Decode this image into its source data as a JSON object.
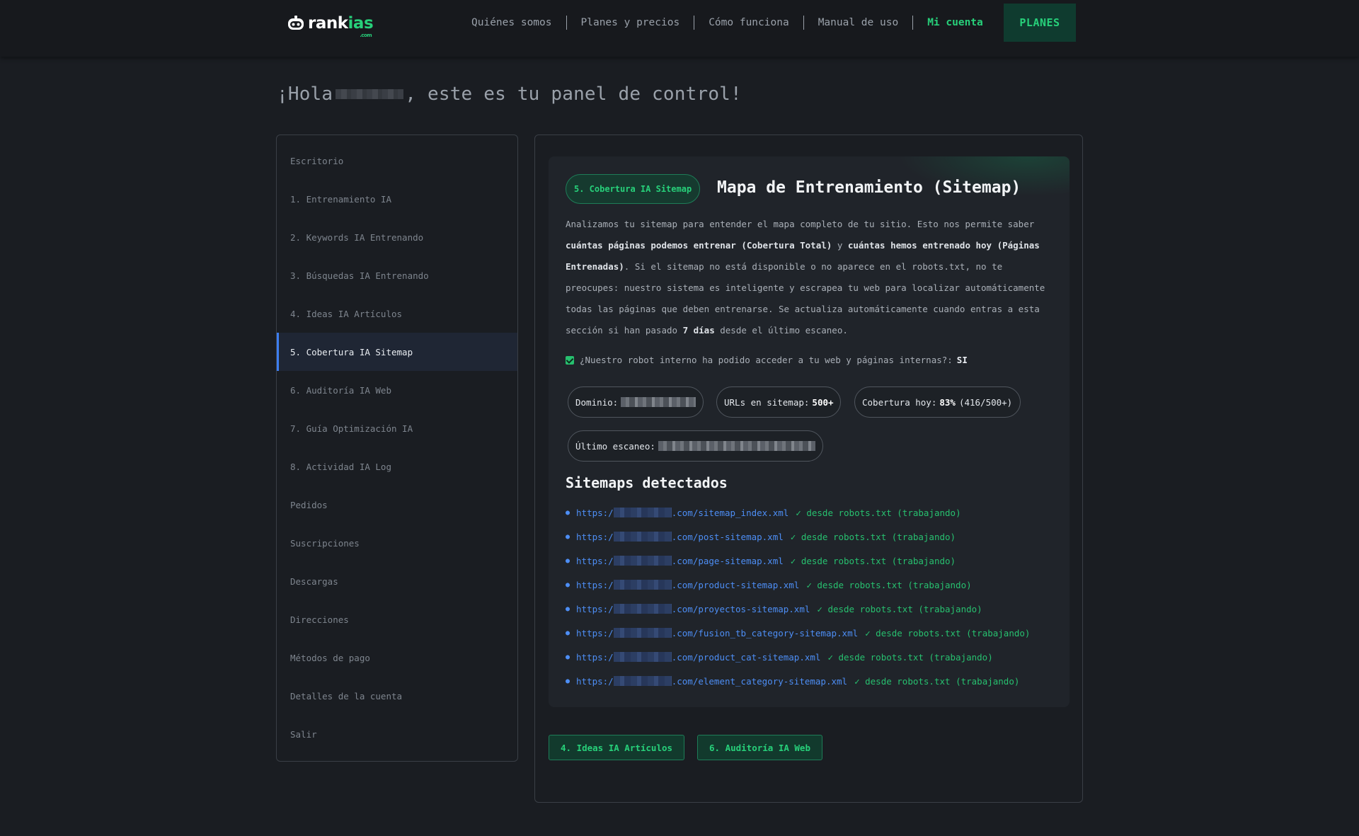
{
  "header": {
    "logo_text_white": "rank",
    "logo_text_green": "ias",
    "logo_sub": ".com",
    "nav": [
      "Quiénes somos",
      "Planes y precios",
      "Cómo funciona",
      "Manual de uso",
      "Mi cuenta"
    ],
    "active_nav": "Mi cuenta",
    "cta_label": "PLANES"
  },
  "greeting": {
    "prefix": "¡Hola",
    "suffix": ", este es tu panel de control!"
  },
  "sidebar": {
    "items": [
      "Escritorio",
      "1. Entrenamiento IA",
      "2. Keywords IA Entrenando",
      "3. Búsquedas IA Entrenando",
      "4. Ideas IA Artículos",
      "5. Cobertura IA Sitemap",
      "6. Auditoría IA Web",
      "7. Guía Optimización IA",
      "8. Actividad IA Log",
      "Pedidos",
      "Suscripciones",
      "Descargas",
      "Direcciones",
      "Métodos de pago",
      "Detalles de la cuenta",
      "Salir"
    ],
    "active_item": "5. Cobertura IA Sitemap"
  },
  "card": {
    "tag": "5. Cobertura IA Sitemap",
    "title": "Mapa de Entrenamiento (Sitemap)",
    "desc_1": "Analizamos tu sitemap para entender el mapa completo de tu sitio. Esto nos permite saber ",
    "desc_b1": "cuántas páginas podemos entrenar (Cobertura Total)",
    "desc_2": " y ",
    "desc_b2": "cuántas hemos entrenado hoy (Páginas Entrenadas)",
    "desc_3": ". Si el sitemap no está disponible o no aparece en el robots.txt, no te preocupes: nuestro sistema es inteligente y escrapea tu web para localizar automáticamente todas las páginas que deben entrenarse. Se actualiza automáticamente cuando entras a esta sección si han pasado ",
    "desc_b3": "7 días",
    "desc_4": " desde el último escaneo.",
    "check_question": "¿Nuestro robot interno ha podido acceder a tu web y páginas internas?:",
    "check_answer": "SI",
    "domain_label": "Dominio:",
    "urls_label": "URLs en sitemap:",
    "urls_value": "500+",
    "coverage_label": "Cobertura hoy:",
    "coverage_value": "83%",
    "coverage_detail": "(416/500+)",
    "scan_label": "Último escaneo:",
    "sitemaps_heading": "Sitemaps detectados",
    "sitemaps": [
      {
        "prefix": "https:/",
        "path": ".com/sitemap_index.xml",
        "note": "✓ desde robots.txt (trabajando)"
      },
      {
        "prefix": "https:/",
        "path": ".com/post-sitemap.xml",
        "note": "✓ desde robots.txt (trabajando)"
      },
      {
        "prefix": "https:/",
        "path": ".com/page-sitemap.xml",
        "note": "✓ desde robots.txt (trabajando)"
      },
      {
        "prefix": "https:/",
        "path": ".com/product-sitemap.xml",
        "note": "✓ desde robots.txt (trabajando)"
      },
      {
        "prefix": "https:/",
        "path": ".com/proyectos-sitemap.xml",
        "note": "✓ desde robots.txt (trabajando)"
      },
      {
        "prefix": "https:/",
        "path": ".com/fusion_tb_category-sitemap.xml",
        "note": "✓ desde robots.txt (trabajando)"
      },
      {
        "prefix": "https:/",
        "path": ".com/product_cat-sitemap.xml",
        "note": "✓ desde robots.txt (trabajando)"
      },
      {
        "prefix": "https:/",
        "path": ".com/element_category-sitemap.xml",
        "note": "✓ desde robots.txt (trabajando)"
      }
    ]
  },
  "footer_nav": {
    "prev_label": "4. Ideas IA Artículos",
    "next_label": "6. Auditoría IA Web"
  },
  "colors": {
    "background": "#1a1d22",
    "accent_green": "#27d07a",
    "link_blue": "#4d8ef5",
    "active_sidebar": "#1f2634"
  }
}
